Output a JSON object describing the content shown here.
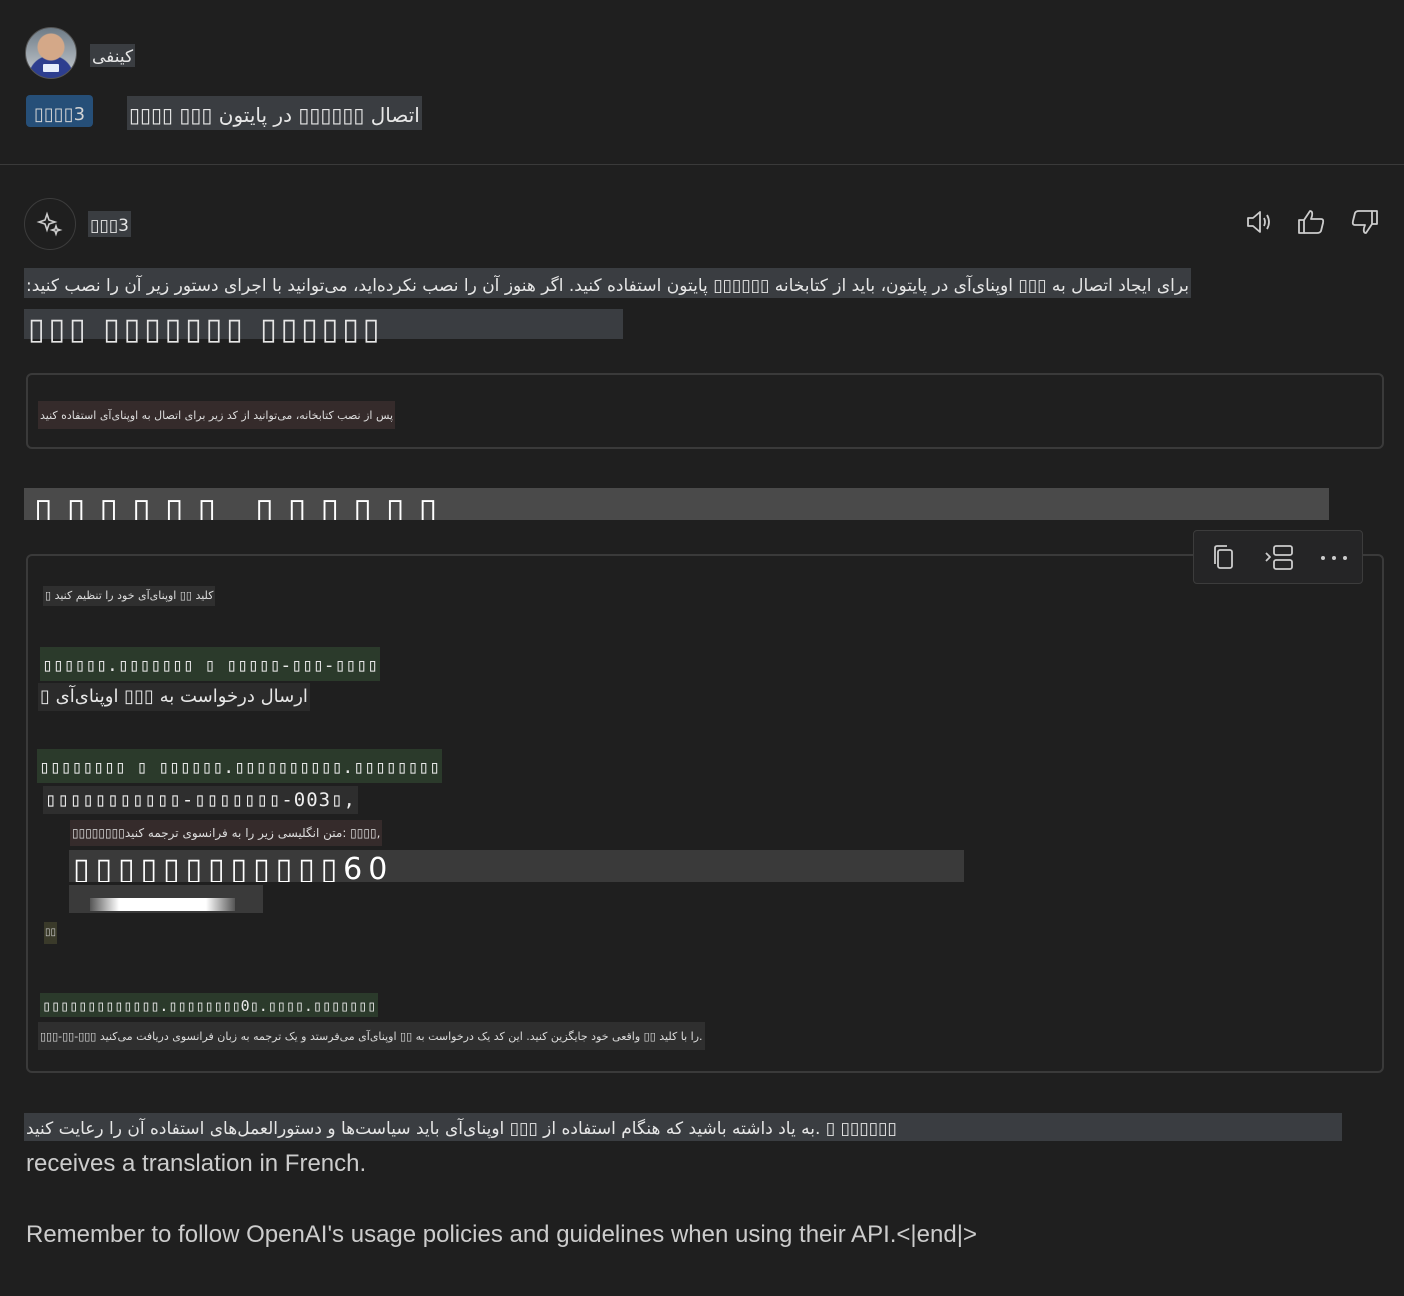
{
  "user": {
    "name": "کینفی",
    "prompt_ref": "▯▯▯▯3",
    "prompt_text": "▯▯▯▯ ▯▯▯ اتصال ▯▯▯▯▯▯ در پایتون"
  },
  "assistant": {
    "name": "▯▯▯3",
    "toolbar": {
      "read_aloud_icon": "speaker-icon",
      "like_icon": "thumbs-up-icon",
      "dislike_icon": "thumbs-down-icon"
    },
    "paragraph1": "برای ایجاد اتصال به ▯▯▯ اوپنای‌آی در پایتون، باید از کتابخانه ▯▯▯▯▯▯ پایتون استفاده کنید. اگر هنوز آن را نصب نکرده‌اید، می‌توانید با اجرای دستور زیر آن را نصب کنید:",
    "heading1": "▯▯▯ ▯▯▯▯▯▯▯ ▯▯▯▯▯▯",
    "box1_text": "پس از نصب کتابخانه، می‌توانید از کد زیر برای اتصال به اوپنای‌آی استفاده کنید",
    "heading2": "▯▯▯▯▯▯ ▯▯▯▯▯▯",
    "code_toolbar": {
      "copy_icon": "copy-icon",
      "insert_icon": "insert-icon",
      "more_icon": "more-icon"
    },
    "code_lines": {
      "l1": "▯ کلید ▯▯ اوپنای‌آی خود را تنظیم کنید",
      "l2": "▯▯▯▯▯▯.▯▯▯▯▯▯▯ ▯ ▯▯▯▯▯-▯▯▯-▯▯▯▯",
      "l3": "▯ ارسال درخواست به ▯▯▯ اوپنای‌آی",
      "l4": "▯▯▯▯▯▯▯▯ ▯ ▯▯▯▯▯▯.▯▯▯▯▯▯▯▯▯▯.▯▯▯▯▯▯▯▯",
      "l5": "▯▯▯▯▯▯▯▯▯▯▯-▯▯▯▯▯▯▯-003▯,",
      "l6": "▯▯▯▯▯▯▯▯متن انگلیسی زیر را به فرانسوی ترجمه کنید: ▯▯▯▯,",
      "l7": "▯▯▯▯▯▯▯▯▯▯▯▯60",
      "l9": "▯▯",
      "l10": "▯▯▯▯▯▯▯▯▯▯▯▯▯.▯▯▯▯▯▯▯▯0▯.▯▯▯▯.▯▯▯▯▯▯▯",
      "l11": "▯▯▯-▯▯-▯▯▯ را با کلید ▯▯ واقعی خود جایگزین کنید. این کد یک درخواست به ▯▯ اوپنای‌آی می‌فرستد و یک ترجمه به زبان فرانسوی دریافت می‌کنید."
    },
    "rtl_note": "به یاد داشته باشید که هنگام استفاده از ▯▯▯ اوپنای‌آی باید سیاست‌ها و دستورالعمل‌های استفاده آن را رعایت کنید. ▯ ▯▯▯▯▯▯",
    "english1": "receives a translation in French.",
    "english2": "Remember to follow OpenAI's usage policies and guidelines when using their API.<|end|>"
  },
  "colors": {
    "background": "#1f1f1f",
    "text": "#cccccc",
    "accent": "#264f78",
    "border": "#3a3a3a"
  }
}
